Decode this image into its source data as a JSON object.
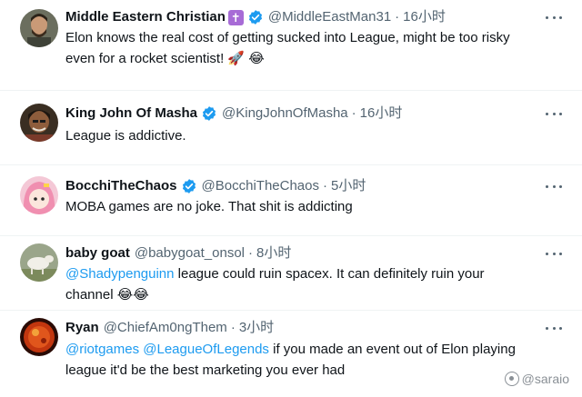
{
  "replies": [
    {
      "name": "Middle Eastern Christian",
      "name_badge": "✝",
      "handle": "@MiddleEastMan31",
      "time": "16小时",
      "text": "Elon knows the real cost of getting sucked into League, might be too risky even for a rocket scientist!",
      "emoji": "🚀 😂",
      "verified": true
    },
    {
      "name": "King John Of Masha",
      "handle": "@KingJohnOfMasha",
      "time": "16小时",
      "text": "League is addictive.",
      "verified": true
    },
    {
      "name": "BocchiTheChaos",
      "handle": "@BocchiTheChaos",
      "time": "5小时",
      "text": "MOBA games are no joke. That shit is addicting",
      "verified": true
    },
    {
      "name": "baby goat",
      "handle": "@babygoat_onsol",
      "time": "8小时",
      "mention": "@Shadypenguinn",
      "text": " league could ruin spacex. It can definitely ruin your channel",
      "emoji": "😂😂",
      "verified": false
    },
    {
      "name": "Ryan",
      "handle": "@ChiefAm0ngThem",
      "time": "3小时",
      "mention1": "@riotgames",
      "mention2": "@LeagueOfLegends",
      "text": " if you made an event out of Elon playing league it'd be the best marketing you ever had",
      "verified": false
    }
  ],
  "separator": "·",
  "watermark": "@saraio",
  "colors": {
    "link": "#1d9bf0",
    "verified": "#1d9bf0",
    "secondary_text": "#536471"
  }
}
